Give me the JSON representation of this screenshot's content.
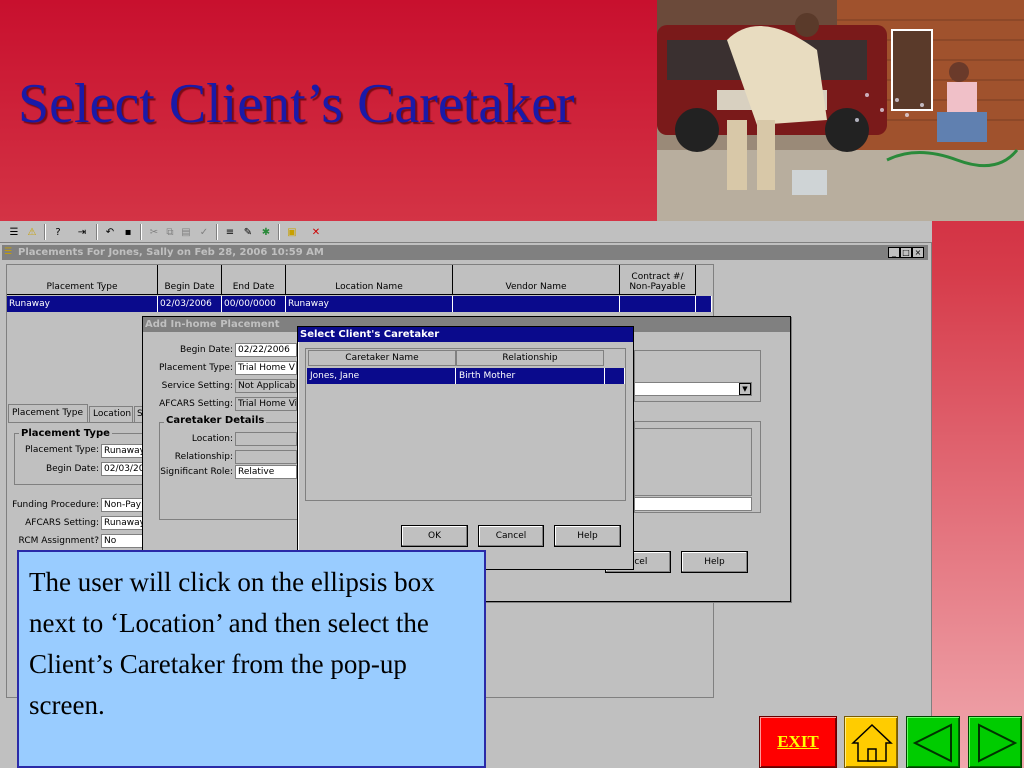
{
  "slide": {
    "title": "Select Client’s Caretaker",
    "callout": "The user will click on the ellipsis box next to ‘Location’ and then select the Client’s Caretaker from the pop-up screen."
  },
  "placements_window": {
    "title": "Placements For Jones, Sally on Feb 28, 2006 10:59 AM",
    "columns": [
      "Placement Type",
      "Begin Date",
      "End Date",
      "Location Name",
      "Vendor Name",
      "Contract #/\nNon-Payable"
    ],
    "rows": [
      [
        "Runaway",
        "02/03/2006",
        "00/00/0000",
        "Runaway",
        "",
        ""
      ]
    ],
    "tabs": [
      "Placement Type",
      "Location",
      "S"
    ],
    "placement_type_group": {
      "heading": "Placement Type",
      "type_label": "Placement Type:",
      "type_value": "Runaway",
      "begin_label": "Begin Date:",
      "begin_value": "02/03/200"
    },
    "funding_label": "Funding Procedure:",
    "funding_value": "Non-Pay",
    "afcars_label": "AFCARS Setting:",
    "afcars_value": "Runaway",
    "rcm_label": "RCM Assignment?",
    "rcm_value": "No"
  },
  "add_dialog": {
    "title": "Add In-home Placement",
    "begin_label": "Begin Date:",
    "begin_value": "02/22/2006",
    "ptype_label": "Placement Type:",
    "ptype_value": "Trial Home V",
    "service_label": "Service Setting:",
    "service_value": "Not Applicabl",
    "afcars_label": "AFCARS Setting:",
    "afcars_value": "Trial Home Vi",
    "caretaker_heading": "Caretaker Details",
    "location_label": "Location:",
    "relationship_label": "Relationship:",
    "role_label": "Significant Role:",
    "role_value": "Relative",
    "cancel_label": "ncel",
    "help_label": "Help"
  },
  "select_dialog": {
    "title": "Select Client's Caretaker",
    "columns": [
      "Caretaker Name",
      "Relationship"
    ],
    "rows": [
      [
        "Jones, Jane",
        "Birth Mother"
      ]
    ],
    "ok_label": "OK",
    "cancel_label": "Cancel",
    "help_label": "Help"
  },
  "nav": {
    "exit_label": "EXIT"
  },
  "colors": {
    "title_blue": "#1a1aa8",
    "selection_navy": "#0a0a8c",
    "callout_bg": "#99ccff",
    "exit_red": "#ff0000",
    "home_yellow": "#ffcc00",
    "nav_green": "#00cc00"
  },
  "icons": [
    "toolbar-icons",
    "home-icon",
    "back-arrow-icon",
    "next-arrow-icon",
    "close-icon"
  ]
}
